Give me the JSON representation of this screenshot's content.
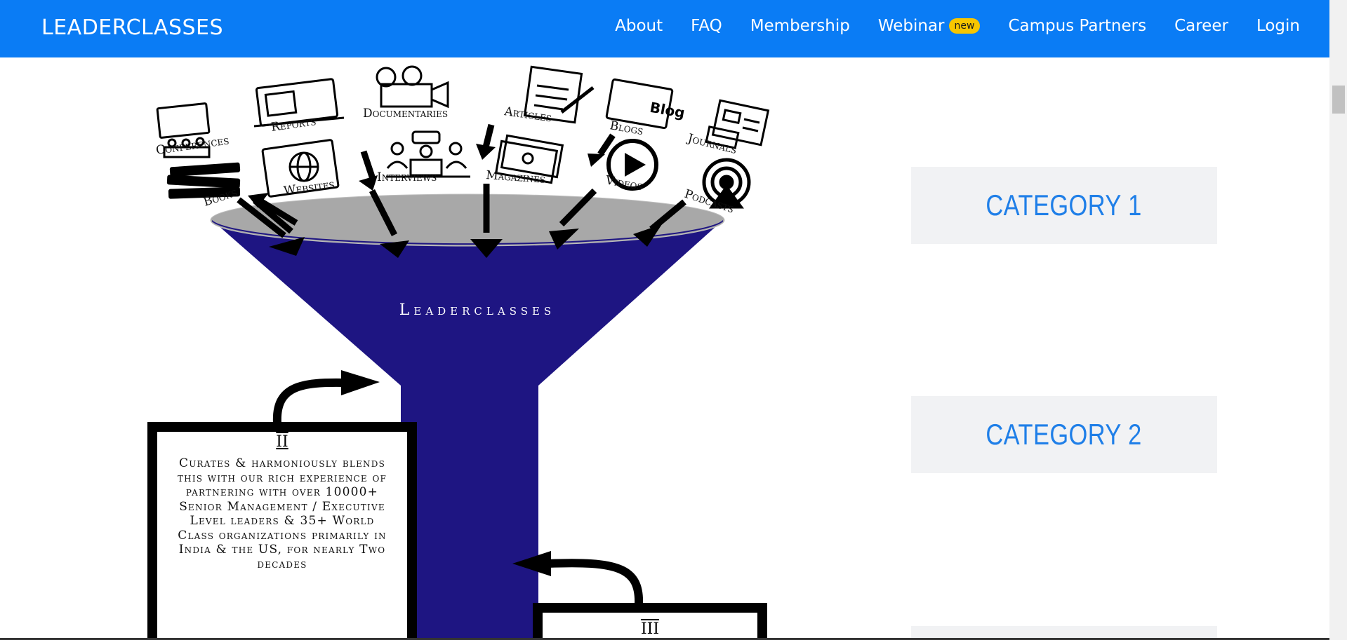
{
  "nav": {
    "brand": "LEADERCLASSES",
    "links": [
      "About",
      "FAQ",
      "Membership",
      "Webinar",
      "Campus Partners",
      "Career",
      "Login"
    ],
    "webinar_badge": "new"
  },
  "infographic": {
    "sources": [
      "Conferences",
      "Reports",
      "Documentaries",
      "Articles",
      "Blogs",
      "Journals",
      "Books",
      "Websites",
      "Interviews",
      "Magazines",
      "Videos",
      "Podcasts"
    ],
    "blog_icon_text": "Blog",
    "funnel_label": "Leaderclasses",
    "box2_numeral": "II",
    "box2_text": "Curates & harmoniously blends this with our rich experience of partnering with over 10000+ Senior Management / Executive Level leaders & 35+ World Class organizations primarily in India & the US, for nearly Two decades",
    "box3_numeral": "III"
  },
  "categories": [
    "CATEGORY 1",
    "CATEGORY 2"
  ],
  "colors": {
    "nav": "#0a7cf5",
    "funnel": "#1e1582",
    "category_text": "#1f7fe8",
    "category_bg": "#f1f2f4",
    "badge": "#f7c600"
  }
}
